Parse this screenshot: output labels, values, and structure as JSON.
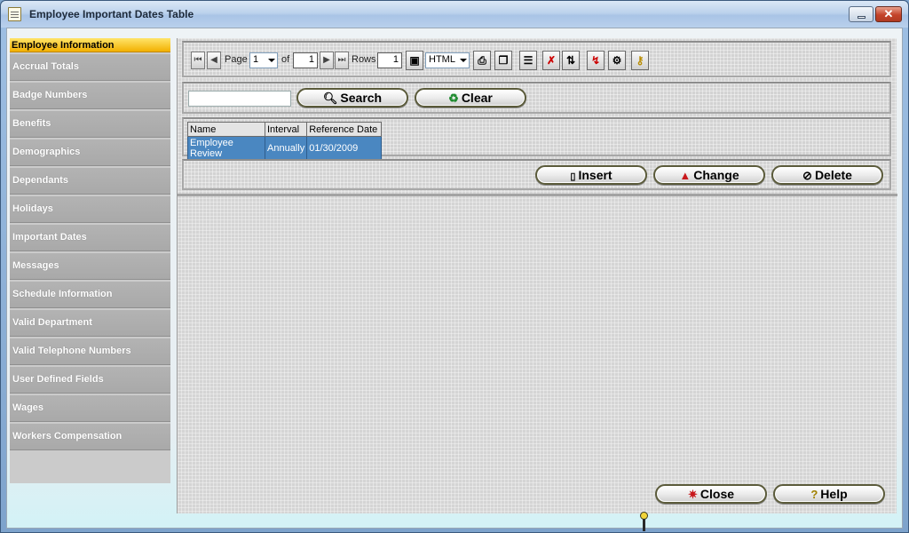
{
  "window": {
    "title": "Employee Important Dates Table",
    "minimize_icon": "minimize-icon",
    "close_glyph": "✕"
  },
  "sidebar": {
    "header": "Employee Information",
    "items": [
      "Accrual Totals",
      "Badge Numbers",
      "Benefits",
      "Demographics",
      "Dependants",
      "Holidays",
      "Important Dates",
      "Messages",
      "Schedule Information",
      "Valid Department",
      "Valid Telephone Numbers",
      "User Defined Fields",
      "Wages",
      "Workers Compensation"
    ]
  },
  "toolbar": {
    "page_label": "Page",
    "page_value": "1",
    "of_label": "of",
    "page_count": "1",
    "rows_label": "Rows",
    "rows_value": "1",
    "format_value": "HTML",
    "icons": [
      "first-page-icon",
      "prev-page-icon",
      "next-page-icon",
      "last-page-icon",
      "save-icon",
      "print-icon",
      "copy-icon",
      "properties-icon",
      "clear-filter-icon",
      "sort-icon",
      "sort-clear-icon",
      "settings-icon",
      "key-icon"
    ]
  },
  "search": {
    "input_value": "",
    "search_label": "Search",
    "clear_label": "Clear"
  },
  "grid": {
    "columns": [
      "Name",
      "Interval",
      "Reference Date"
    ],
    "rows": [
      [
        "Employee Review",
        "Annually",
        "01/30/2009"
      ]
    ],
    "selected_color": "#4a87c1"
  },
  "actions": {
    "insert_label": "Insert",
    "change_label": "Change",
    "delete_label": "Delete"
  },
  "footer": {
    "close_label": "Close",
    "help_label": "Help"
  }
}
